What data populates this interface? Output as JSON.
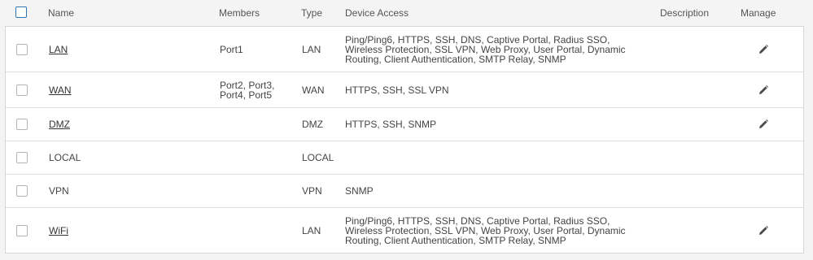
{
  "columns": {
    "name": "Name",
    "members": "Members",
    "type": "Type",
    "access": "Device Access",
    "description": "Description",
    "manage": "Manage"
  },
  "rows": [
    {
      "name": "LAN",
      "members": "Port1",
      "type": "LAN",
      "access": "Ping/Ping6, HTTPS, SSH, DNS, Captive Portal, Radius SSO, Wireless Protection, SSL VPN, Web Proxy, User Portal, Dynamic Routing, Client Authentication, SMTP Relay, SNMP",
      "description": ""
    },
    {
      "name": "WAN",
      "members": "Port2, Port3, Port4, Port5",
      "type": "WAN",
      "access": "HTTPS, SSH, SSL VPN",
      "description": ""
    },
    {
      "name": "DMZ",
      "members": "",
      "type": "DMZ",
      "access": "HTTPS, SSH, SNMP",
      "description": ""
    },
    {
      "name": "LOCAL",
      "members": "",
      "type": "LOCAL",
      "access": "",
      "description": ""
    },
    {
      "name": "VPN",
      "members": "",
      "type": "VPN",
      "access": "SNMP",
      "description": ""
    },
    {
      "name": "WiFi",
      "members": "",
      "type": "LAN",
      "access": "Ping/Ping6, HTTPS, SSH, DNS, Captive Portal, Radius SSO, Wireless Protection, SSL VPN, Web Proxy, User Portal, Dynamic Routing, Client Authentication, SMTP Relay, SNMP",
      "description": ""
    }
  ],
  "icons": {
    "edit": "pencil-icon"
  },
  "colors": {
    "accent": "#2f73b5",
    "border": "#d7d7d7",
    "edit_icon": "#4a4a4a"
  }
}
